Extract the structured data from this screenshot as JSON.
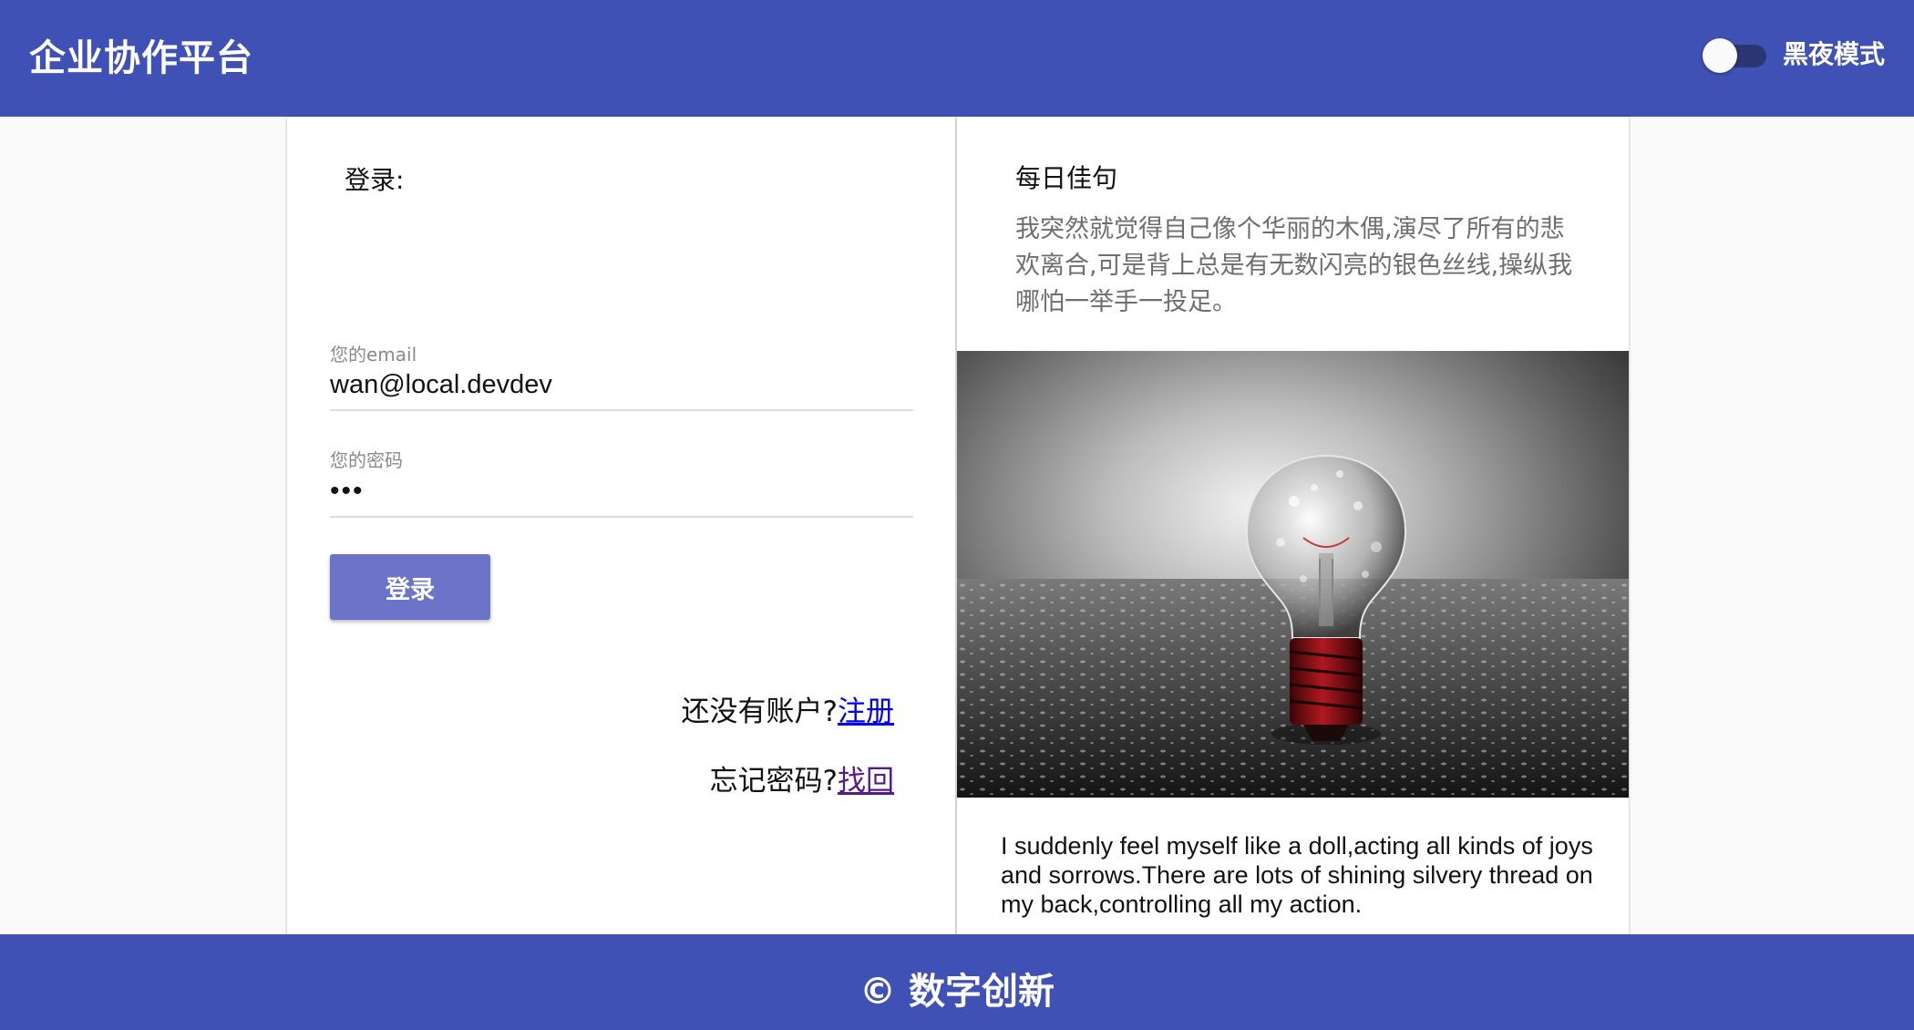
{
  "header": {
    "title": "企业协作平台",
    "dark_mode_label": "黑夜模式",
    "dark_mode_on": false
  },
  "login": {
    "heading": "登录:",
    "email_label": "您的email",
    "email_value": "wan@local.devdev",
    "password_label": "您的密码",
    "password_value": "•••",
    "submit_label": "登录",
    "register_prompt": "还没有账户?",
    "register_link": "注册",
    "recover_prompt": "忘记密码?",
    "recover_link": "找回"
  },
  "quote": {
    "title": "每日佳句",
    "text_zh": "我突然就觉得自己像个华丽的木偶,演尽了所有的悲欢离合,可是背上总是有无数闪亮的银色丝线,操纵我哪怕一举手一投足。",
    "image": "lightbulb-photo",
    "text_en": "I suddenly feel myself like a doll,acting all kinds of joys and sorrows.There are lots of shining silvery thread on my back,controlling all my action."
  },
  "footer": {
    "copyright": "© 数字创新"
  },
  "colors": {
    "primary": "#3f51b5",
    "button": "#6b74c9",
    "link": "#0000ee",
    "visited_link": "#551a8b"
  }
}
